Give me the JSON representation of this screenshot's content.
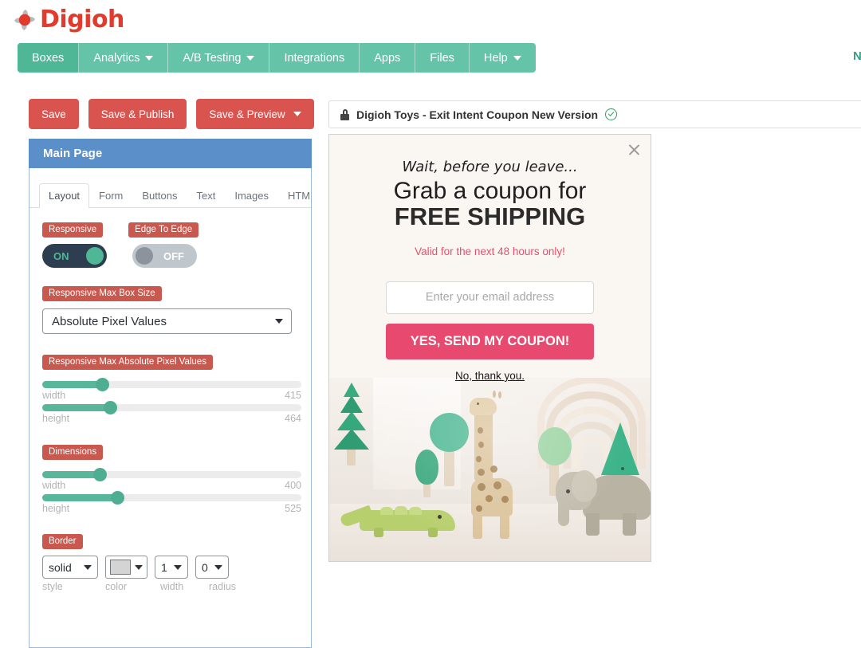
{
  "brand": {
    "name": "Digioh",
    "logo_icon": "pinwheel-logo-icon",
    "color": "#e03b2c"
  },
  "nav": {
    "items": [
      {
        "label": "Boxes",
        "active": true,
        "has_caret": false
      },
      {
        "label": "Analytics",
        "active": false,
        "has_caret": true
      },
      {
        "label": "A/B Testing",
        "active": false,
        "has_caret": true
      },
      {
        "label": "Integrations",
        "active": false,
        "has_caret": false
      },
      {
        "label": "Apps",
        "active": false,
        "has_caret": false
      },
      {
        "label": "Files",
        "active": false,
        "has_caret": false
      },
      {
        "label": "Help",
        "active": false,
        "has_caret": true
      }
    ],
    "bar_color": "#65c4a8",
    "active_color": "#4fb795",
    "cut_off_right_text": "N"
  },
  "toolbar": {
    "save_label": "Save",
    "save_publish_label": "Save & Publish",
    "save_preview_label": "Save & Preview",
    "button_color": "#d9534f"
  },
  "titlebar": {
    "lock_icon": "lock-icon",
    "title": "Digioh Toys - Exit Intent Coupon New Version",
    "status_icon": "check-circle-icon",
    "status_color": "#2f9e63"
  },
  "panel": {
    "header": "Main Page",
    "header_color": "#5b8fc9",
    "tabs": [
      {
        "label": "Layout",
        "active": true
      },
      {
        "label": "Form",
        "active": false
      },
      {
        "label": "Buttons",
        "active": false
      },
      {
        "label": "Text",
        "active": false
      },
      {
        "label": "Images",
        "active": false
      },
      {
        "label": "HTML",
        "active": false
      }
    ],
    "toggles": [
      {
        "label": "Responsive",
        "state": "ON",
        "on": true
      },
      {
        "label": "Edge To Edge",
        "state": "OFF",
        "on": false
      }
    ],
    "max_box_size": {
      "label": "Responsive Max Box Size",
      "selected": "Absolute Pixel Values"
    },
    "responsive_max_abs": {
      "label": "Responsive Max Absolute Pixel Values",
      "sliders": [
        {
          "name": "width",
          "value": "415",
          "pct": 23
        },
        {
          "name": "height",
          "value": "464",
          "pct": 26
        }
      ]
    },
    "dimensions": {
      "label": "Dimensions",
      "sliders": [
        {
          "name": "width",
          "value": "400",
          "pct": 22
        },
        {
          "name": "height",
          "value": "525",
          "pct": 29
        }
      ]
    },
    "border": {
      "label": "Border",
      "style": {
        "value": "solid",
        "caption": "style"
      },
      "color": {
        "value": "#d4d4d4",
        "caption": "color"
      },
      "width": {
        "value": "1",
        "caption": "width"
      },
      "radius": {
        "value": "0",
        "caption": "radius"
      }
    },
    "accent_label_color": "#c9584f",
    "slider_color": "#58b79a"
  },
  "popup": {
    "close_icon": "close-icon",
    "pretitle": "Wait, before you leave...",
    "headline_1": "Grab a coupon for",
    "headline_2": "FREE SHIPPING",
    "subtext": "Valid for the next 48 hours only!",
    "subtext_color": "#e94f6d",
    "email_placeholder": "Enter your email address",
    "cta_label": "YES, SEND MY COUPON!",
    "cta_color": "#e84a6f",
    "decline_label": "No, thank you.",
    "background": "#faf6f2",
    "photo_alt": "wooden-toy-animals-photo"
  }
}
